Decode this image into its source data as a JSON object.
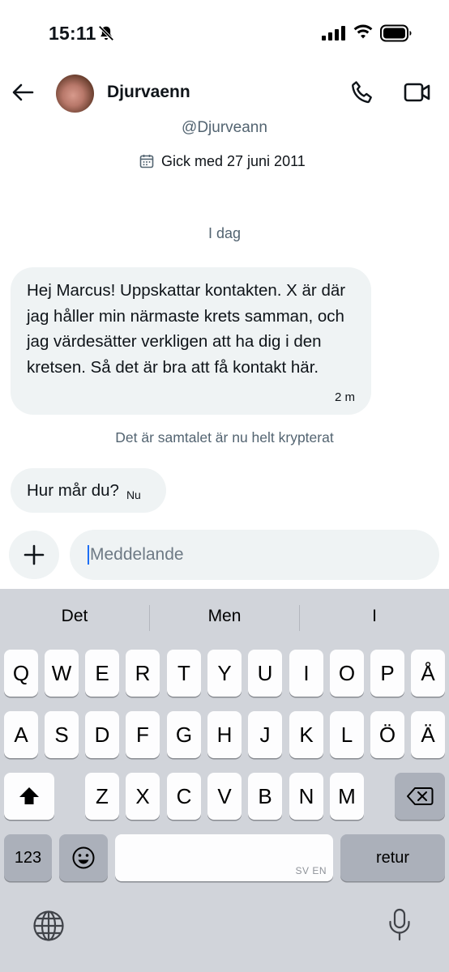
{
  "status_bar": {
    "time": "15:11",
    "icons": [
      "bell-slash-icon",
      "cellular-signal-icon",
      "wifi-icon",
      "battery-icon"
    ]
  },
  "header": {
    "contact_name": "Djurvaenn",
    "avatar": "avatar",
    "icons": [
      "back-arrow-icon",
      "phone-icon",
      "video-camera-icon"
    ]
  },
  "profile": {
    "handle": "@Djurveann",
    "joined": "Gick med 27 juni 2011",
    "joined_icon": "calendar-icon"
  },
  "conversation": {
    "day_label": "I dag",
    "messages": [
      {
        "text": "Hej Marcus! Uppskattar kontakten. X är där jag håller min närmaste krets samman, och jag värdesätter verkligen att ha dig i den kretsen. Så det är bra att få kontakt här.",
        "time": "2 m"
      },
      {
        "text": "Hur mår du?",
        "time": "Nu"
      }
    ],
    "encryption_notice": "Det är samtalet är nu helt krypterat"
  },
  "composer": {
    "placeholder": "Meddelande",
    "add_icon": "plus-icon"
  },
  "keyboard": {
    "suggestions": [
      "Det",
      "Men",
      "I"
    ],
    "row1": [
      "Q",
      "W",
      "E",
      "R",
      "T",
      "Y",
      "U",
      "I",
      "O",
      "P",
      "Å"
    ],
    "row2": [
      "A",
      "S",
      "D",
      "F",
      "G",
      "H",
      "J",
      "K",
      "L",
      "Ö",
      "Ä"
    ],
    "row3": [
      "Z",
      "X",
      "C",
      "V",
      "B",
      "N",
      "M"
    ],
    "numbers_label": "123",
    "return_label": "retur",
    "space_languages": "SV EN",
    "icons": [
      "shift-icon",
      "backspace-icon",
      "emoji-icon",
      "globe-icon",
      "microphone-icon"
    ]
  },
  "colors": {
    "bubble_bg": "#eff3f4",
    "secondary_text": "#536471",
    "keyboard_bg": "#d1d4da",
    "caret": "#1d6ef5"
  }
}
